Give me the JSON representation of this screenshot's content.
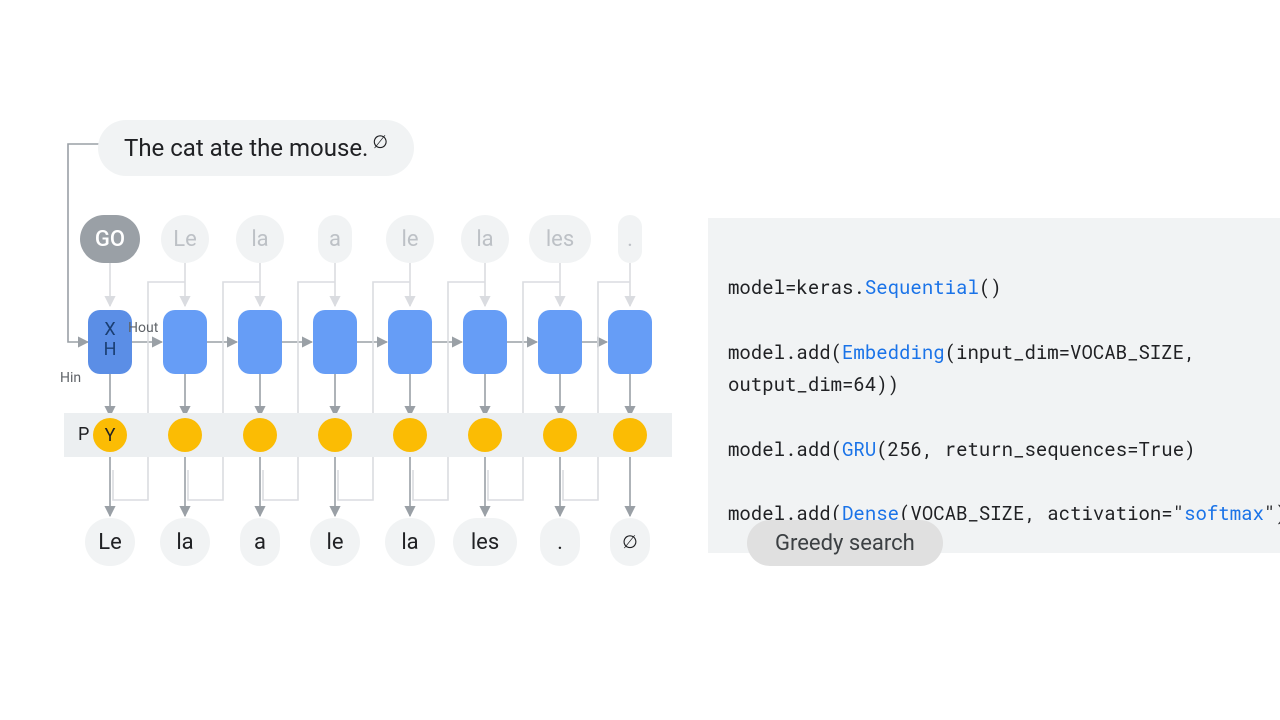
{
  "input": {
    "sentence": "The cat ate the mouse.",
    "eos_symbol": "∅"
  },
  "tokens_top": [
    "GO",
    "Le",
    "la",
    "a",
    "le",
    "la",
    "les",
    "."
  ],
  "tokens_bottom": [
    "Le",
    "la",
    "a",
    "le",
    "la",
    "les",
    ".",
    "∅"
  ],
  "labels": {
    "x": "X",
    "h": "H",
    "y": "Y",
    "p": "P",
    "hin": "Hin",
    "hout": "Hout"
  },
  "code": {
    "l1_pre": "model=keras.",
    "l1_kw": "Sequential",
    "l1_post": "()",
    "l2_pre": "model.add(",
    "l2_kw": "Embedding",
    "l2_post": "(input_dim=VOCAB_SIZE,",
    "l2b": "output_dim=64))",
    "l3_pre": "model.add(",
    "l3_kw": "GRU",
    "l3_post": "(256, return_sequences=True)",
    "l4_pre": "model.add(",
    "l4_kw": "Dense",
    "l4_post_a": "(VOCAB_SIZE, activation=\"",
    "l4_str": "softmax",
    "l4_post_b": "\")"
  },
  "strategy": "Greedy search",
  "colors": {
    "accent_blue": "#669df6",
    "accent_yellow": "#fbbc04",
    "code_keyword": "#1a73e8",
    "grey_pill": "#f1f3f4"
  }
}
